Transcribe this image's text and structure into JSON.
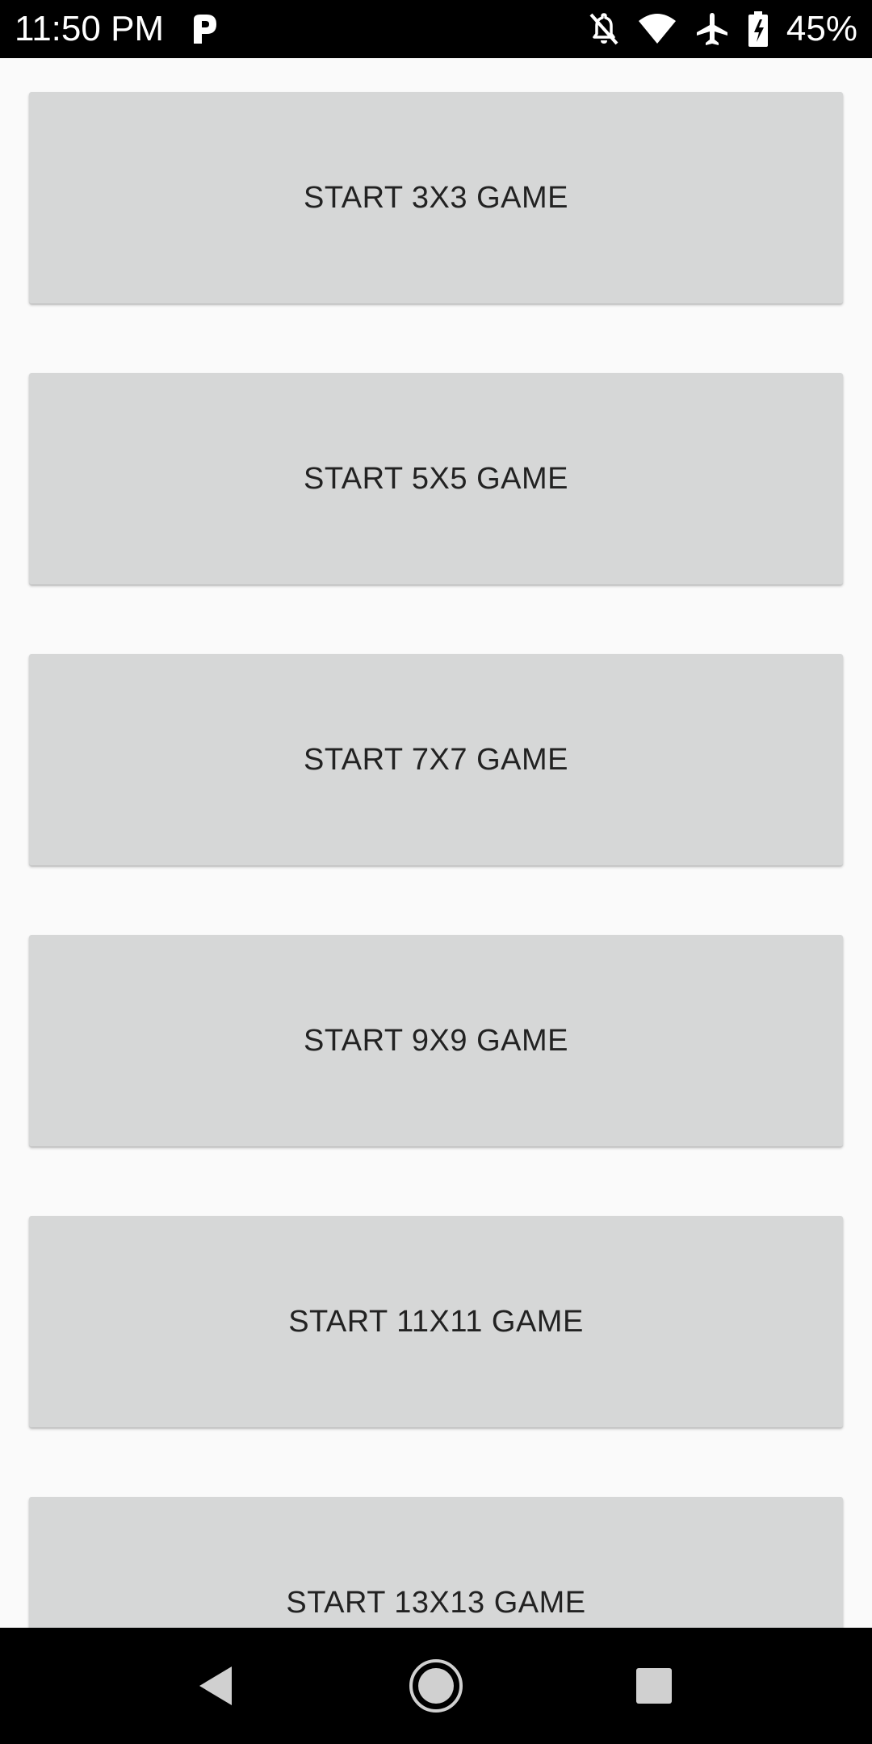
{
  "status_bar": {
    "time": "11:50 PM",
    "battery_percent": "45%",
    "icons": [
      "p-icon",
      "notifications-off-icon",
      "wifi-icon",
      "airplane-icon",
      "battery-charging-icon"
    ]
  },
  "game_buttons": [
    {
      "label": "START 3X3 GAME"
    },
    {
      "label": "START 5X5 GAME"
    },
    {
      "label": "START 7X7 GAME"
    },
    {
      "label": "START 9X9 GAME"
    },
    {
      "label": "START 11X11 GAME"
    },
    {
      "label": "START 13X13 GAME"
    }
  ],
  "nav_bar": {
    "icons": [
      "back-icon",
      "home-icon",
      "recents-icon"
    ]
  },
  "colors": {
    "status_bar_bg": "#000000",
    "background": "#fafafa",
    "button_bg": "#d6d7d7",
    "button_text": "#222222"
  }
}
